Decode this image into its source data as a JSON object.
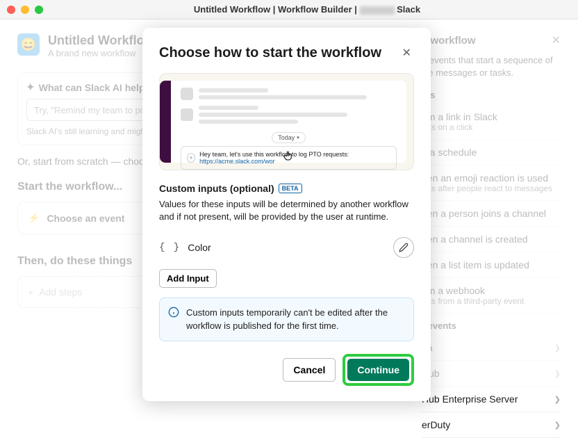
{
  "titlebar": {
    "prefix": "Untitled Workflow | Workflow Builder | ",
    "suffix": " Slack"
  },
  "workflow": {
    "title": "Untitled Workflow",
    "subtitle": "A brand new workflow"
  },
  "ai": {
    "heading": "What can Slack AI help y",
    "placeholder": "Try, \"Remind my team to po",
    "note": "Slack AI's still learning and might m"
  },
  "or_text": "Or, start from scratch — choose",
  "start_section": "Start the workflow...",
  "choose_event": "Choose an event",
  "then_section": "Then, do these things",
  "add_steps": "Add steps",
  "right_panel": {
    "title": "e workflow",
    "desc": "e events that start a sequence of ike messages or tasks.",
    "sub1": "nts",
    "triggers": [
      {
        "title": "om a link in Slack",
        "desc": "arts on a click"
      },
      {
        "title": "n a schedule",
        "desc": ""
      },
      {
        "title": "hen an emoji reaction is used",
        "desc": "arts after people react to messages"
      },
      {
        "title": "hen a person joins a channel",
        "desc": ""
      },
      {
        "title": "hen a channel is created",
        "desc": ""
      },
      {
        "title": "hen a list item is updated",
        "desc": ""
      },
      {
        "title": "om a webhook",
        "desc": "arts from a third-party event"
      }
    ],
    "sub2": "r events",
    "apps": [
      "na",
      "Hub",
      "Hub Enterprise Server",
      "erDuty"
    ]
  },
  "modal": {
    "title": "Choose how to start the workflow",
    "preview": {
      "today": "Today",
      "link_text": "Hey team, let's use this workflow to log PTO requests: ",
      "link_url": "https://acme.slack.com/wor"
    },
    "ci_heading": "Custom inputs (optional)",
    "beta": "BETA",
    "ci_desc": "Values for these inputs will be determined by another workflow and if not present, will be provided by the user at runtime.",
    "inputs": [
      {
        "name": "Color"
      }
    ],
    "add_input": "Add Input",
    "info_text": "Custom inputs temporarily can't be edited after the workflow is published for the first time.",
    "cancel": "Cancel",
    "continue": "Continue"
  }
}
